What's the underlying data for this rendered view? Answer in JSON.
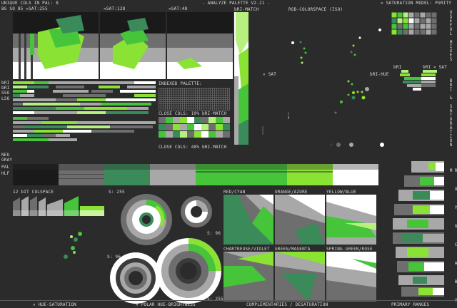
{
  "header": {
    "unique_cols": "UNIQUE COLS IN PAL: 8",
    "sat_line": "BG SO 85  ✕SAT:255",
    "sat_128": "✕SAT:128",
    "sat_48": "✕SAT:48",
    "title": "- ANALYZE PALETTE V2.21 -",
    "saturation_model": "✕ SATURATION MODEL: PURITY"
  },
  "labels": {
    "bri_match": "bRI-MATCH",
    "rgb_colorspace": "RGB-COLORSPACE (ISO)",
    "useful_mixes": "USEFUL MIXES",
    "bri_saturation": "BRI & SATURATION",
    "x_sat": "✕ SAT",
    "bri_hue": "bRI-HUE",
    "bri_a": "bRI",
    "bri_b": "bRI",
    "x_sat2": "✕ SAT",
    "indexed_palette": "INDEXED PALETTE:",
    "close_cols_10": "CLOSE COLS: 10% bRI-MATCH",
    "close_cols_40": "CLOSE COLS: 40% bRI-MATCH",
    "left_tags": [
      "bRI",
      "bRI",
      "SSO",
      "LSO"
    ],
    "neu_gray": [
      "NEU",
      "GRAY",
      "PAL",
      "HLF"
    ],
    "colspace": "12 bIT COLSPACE",
    "s255": "S: 255",
    "s96a": "S: 96",
    "s96b": "S: 96",
    "s255b": "S: 255",
    "rgbcym": "R O Y G C A B V M",
    "red_cyan": "RED/CYAN",
    "orange_azure": "ORANGE/AZURE",
    "yellow_blue": "YELLOW/BLUE",
    "chartreuse_violet": "CHARTREUSE/VIOLET",
    "green_magenta": "GREEN/MAGENTA",
    "spring_rose": "SPRING-GREEN/ROSE"
  },
  "footer": {
    "hue_sat": "✕ HUE-SATURATION",
    "polar": "✕ POLAR HUE-BRIGHTNESS",
    "complementaries": "COMPLEMENTARIES / DESATURATION",
    "primary_ranges": "PRIMARY RANGES"
  },
  "colors": {
    "bg": "#2b2b2b",
    "black": "#000000",
    "dkgreen": "#3a8a5a",
    "green": "#46c43a",
    "lime": "#8ae234",
    "ygreen": "#b8f080",
    "gray": "#6e6e6e",
    "ltgray": "#a8a8a8",
    "white": "#ffffff"
  }
}
